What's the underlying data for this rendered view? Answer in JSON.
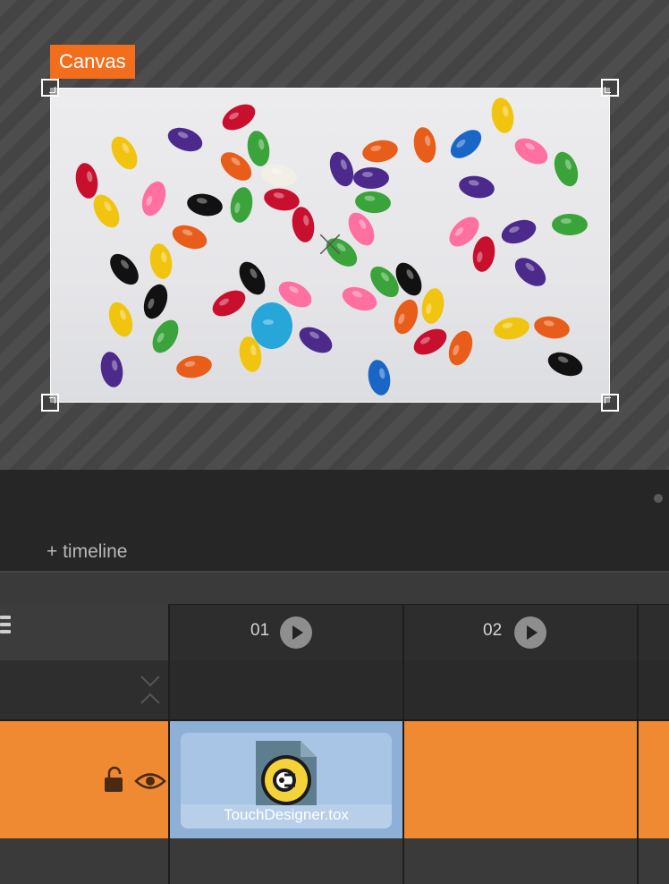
{
  "canvas": {
    "label": "Canvas",
    "accent": "#f26d1c",
    "image": "jelly-beans-photo"
  },
  "timeline_panel": {
    "add_timeline_label": "+ timeline"
  },
  "columns": [
    {
      "number": "01",
      "icon": "play-icon"
    },
    {
      "number": "02",
      "icon": "play-icon"
    }
  ],
  "layer": {
    "color": "#ef8a33",
    "lock_icon": "unlock-icon",
    "visibility_icon": "eye-icon",
    "clip": {
      "name": "TouchDesigner.tox",
      "icon": "touchdesigner-file-icon",
      "color": "#8eafd6"
    }
  },
  "icons": {
    "menu": "menu-icon",
    "collapse": "collapse-chevrons-icon"
  }
}
